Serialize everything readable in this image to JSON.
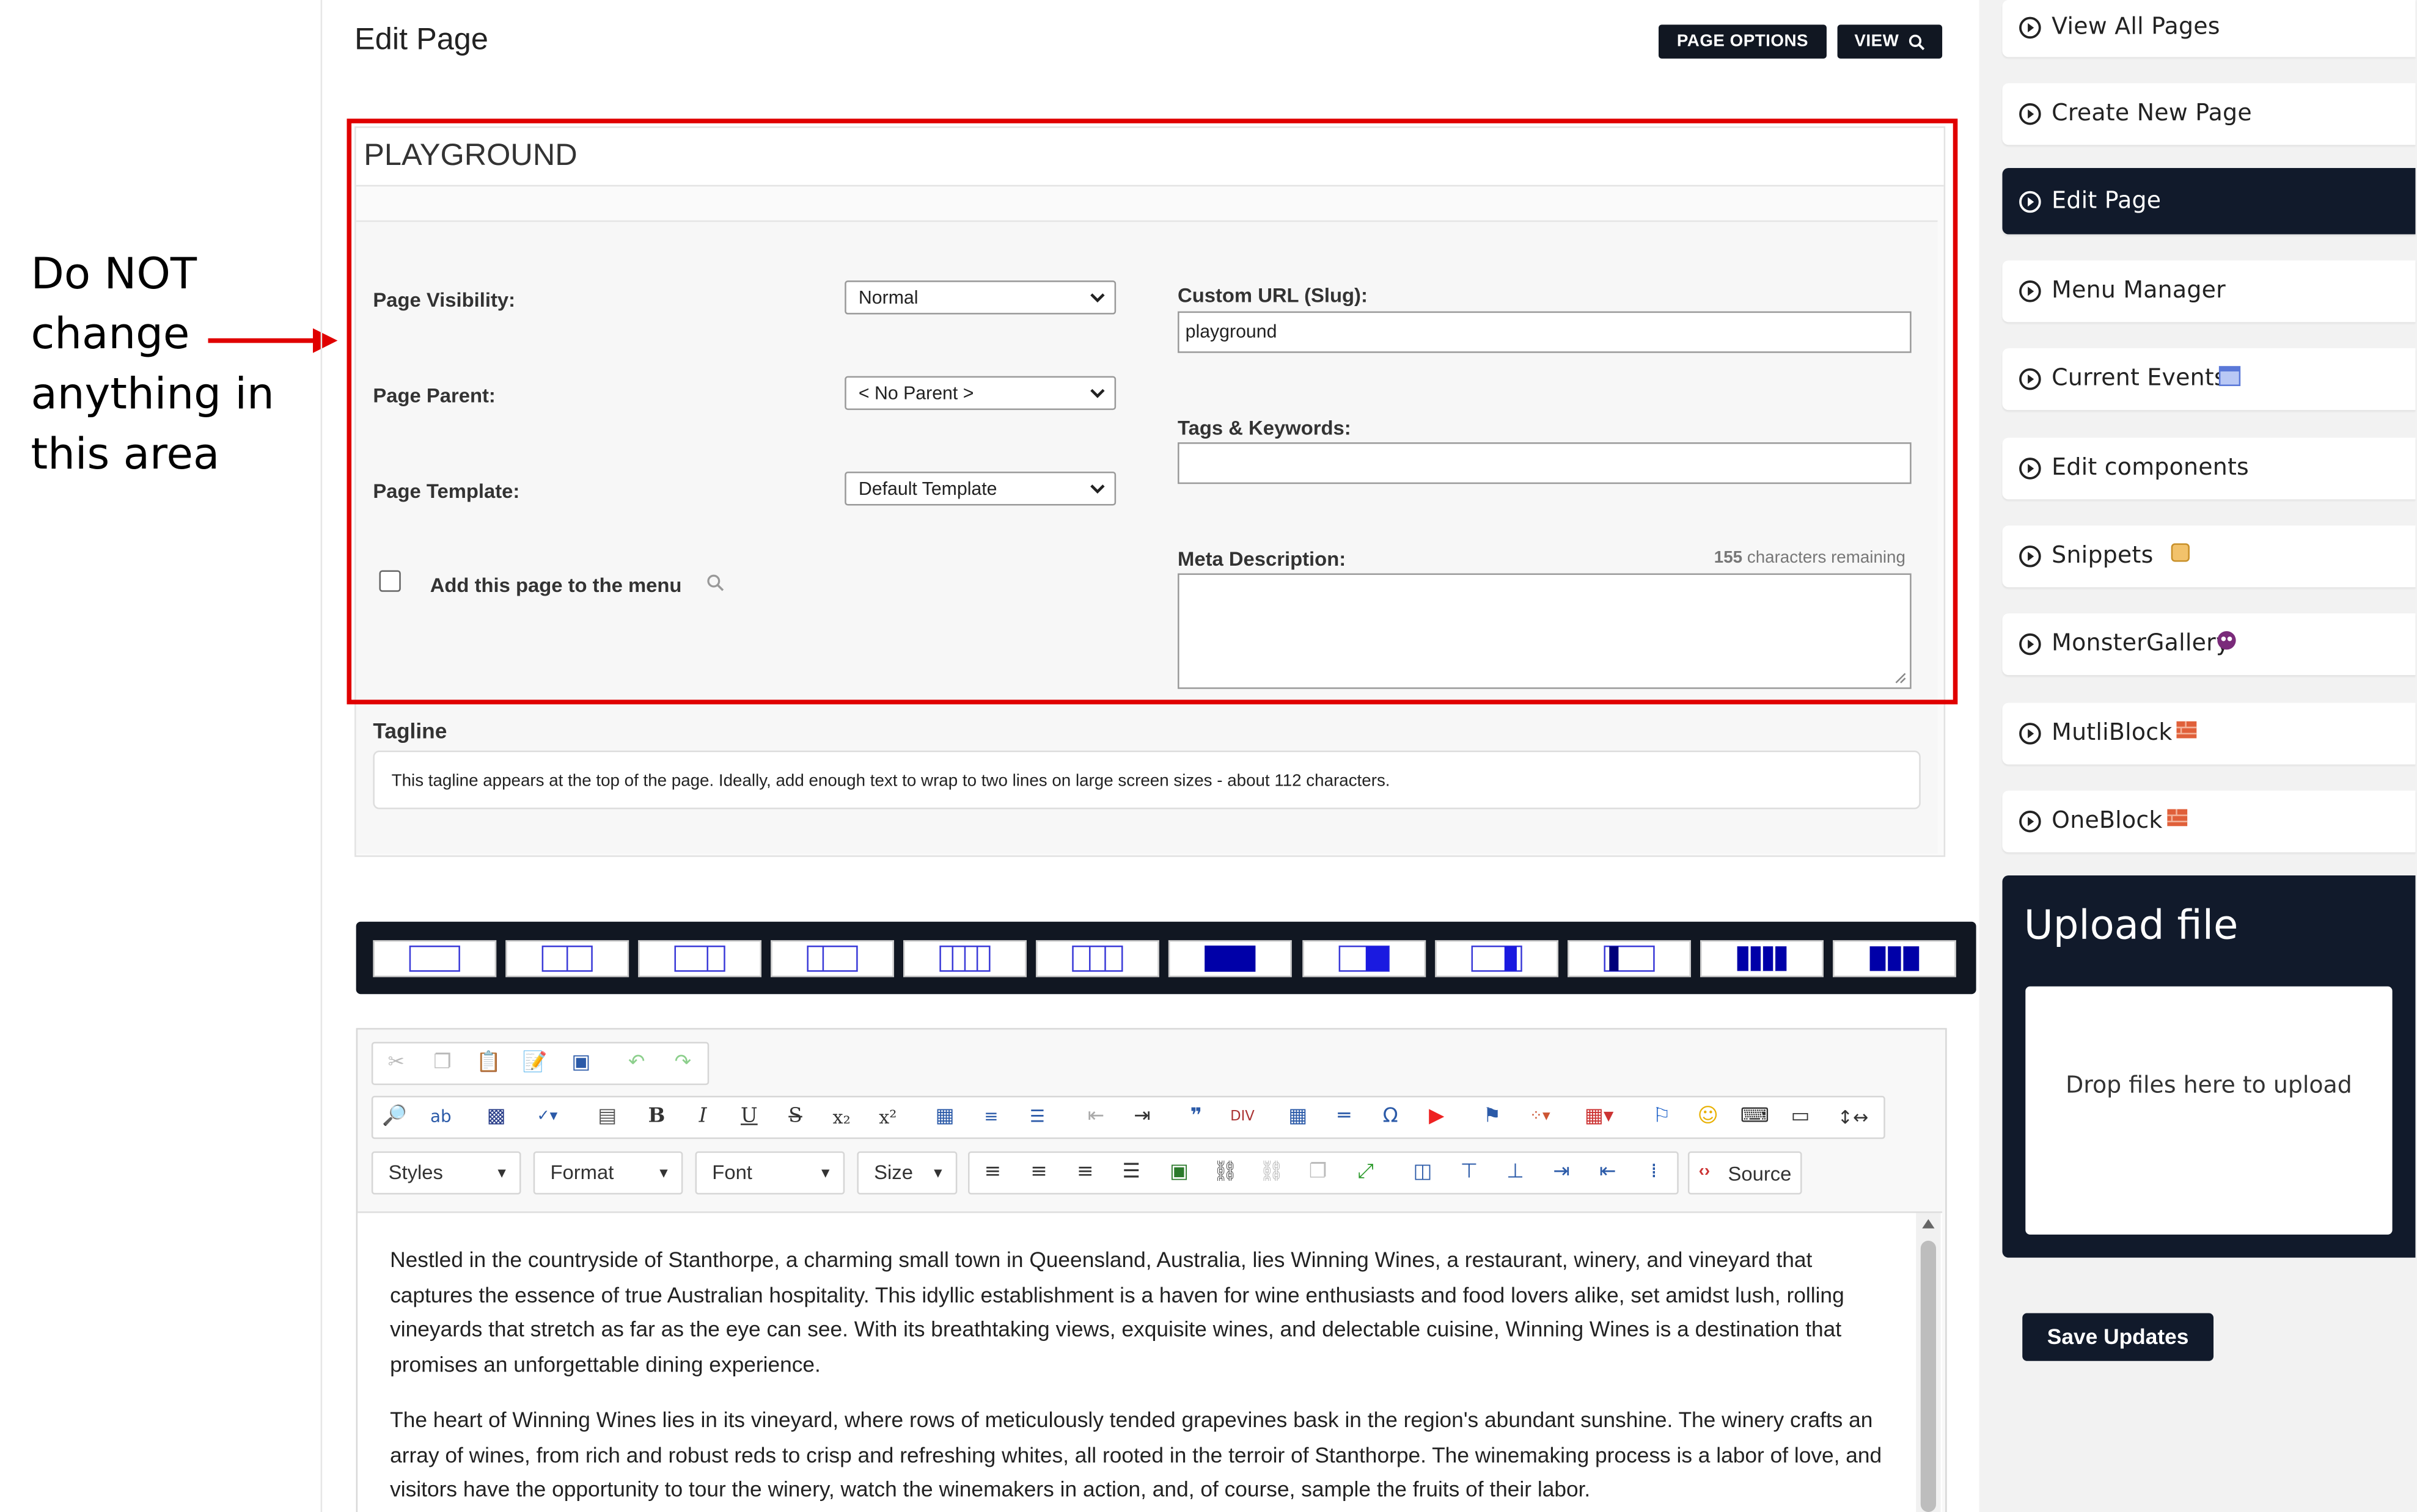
{
  "annotation": {
    "lines": [
      "Do NOT",
      "change",
      "anything in",
      "this area"
    ]
  },
  "header": {
    "title": "Edit Page",
    "page_options_label": "PAGE OPTIONS",
    "view_label": "VIEW",
    "view_icon": "search-icon"
  },
  "settings": {
    "page_title": "PLAYGROUND",
    "visibility_label": "Page Visibility:",
    "visibility_value": "Normal",
    "parent_label": "Page Parent:",
    "parent_value": "< No Parent >",
    "template_label": "Page Template:",
    "template_value": "Default Template",
    "menu_checkbox_label": "Add this page to the menu",
    "menu_checked": false,
    "slug_label": "Custom URL (Slug):",
    "slug_value": "playground",
    "tags_label": "Tags & Keywords:",
    "tags_value": "",
    "meta_label": "Meta Description:",
    "meta_chars_count": "155",
    "meta_chars_text": "characters remaining",
    "meta_value": ""
  },
  "tagline": {
    "label": "Tagline",
    "placeholder": "This tagline appears at the top of the page. Ideally, add enough text to wrap to two lines on large screen sizes - about 112 characters."
  },
  "editor": {
    "combos": [
      "Styles",
      "Format",
      "Font",
      "Size"
    ],
    "source_label": "Source",
    "paragraphs": [
      "Nestled in the countryside of Stanthorpe, a charming small town in Queensland, Australia, lies Winning Wines, a restaurant, winery, and vineyard that captures the essence of true Australian hospitality. This idyllic establishment is a haven for wine enthusiasts and food lovers alike, set amidst lush, rolling vineyards that stretch as far as the eye can see. With its breathtaking views, exquisite wines, and delectable cuisine, Winning Wines is a destination that promises an unforgettable dining experience.",
      "The heart of Winning Wines lies in its vineyard, where rows of meticulously tended grapevines bask in the region's abundant sunshine. The winery crafts an array of wines, from rich and robust reds to crisp and refreshing whites, all rooted in the terroir of Stanthorpe. The winemaking process is a labor of love, and visitors have the opportunity to tour the winery, watch the winemakers in action, and, of course, sample the fruits of their labor."
    ]
  },
  "sidebar": {
    "items": [
      {
        "label": "View All Pages",
        "extra": ""
      },
      {
        "label": "Create New Page",
        "extra": ""
      },
      {
        "label": "Edit Page",
        "extra": "",
        "active": true
      },
      {
        "label": "Menu Manager",
        "extra": ""
      },
      {
        "label": "Current Events",
        "extra": "calendar-icon"
      },
      {
        "label": "Edit components",
        "extra": ""
      },
      {
        "label": "Snippets",
        "extra": "scroll-icon"
      },
      {
        "label": "MonsterGallery",
        "extra": "monster-icon"
      },
      {
        "label": "MutliBlock",
        "extra": "brick-icon"
      },
      {
        "label": "OneBlock",
        "extra": "brick-icon"
      }
    ],
    "upload_title": "Upload file",
    "dropzone_text": "Drop files here to upload",
    "save_label": "Save Updates"
  },
  "colors": {
    "navy": "#111a2b",
    "annotation_red": "#e00000"
  }
}
